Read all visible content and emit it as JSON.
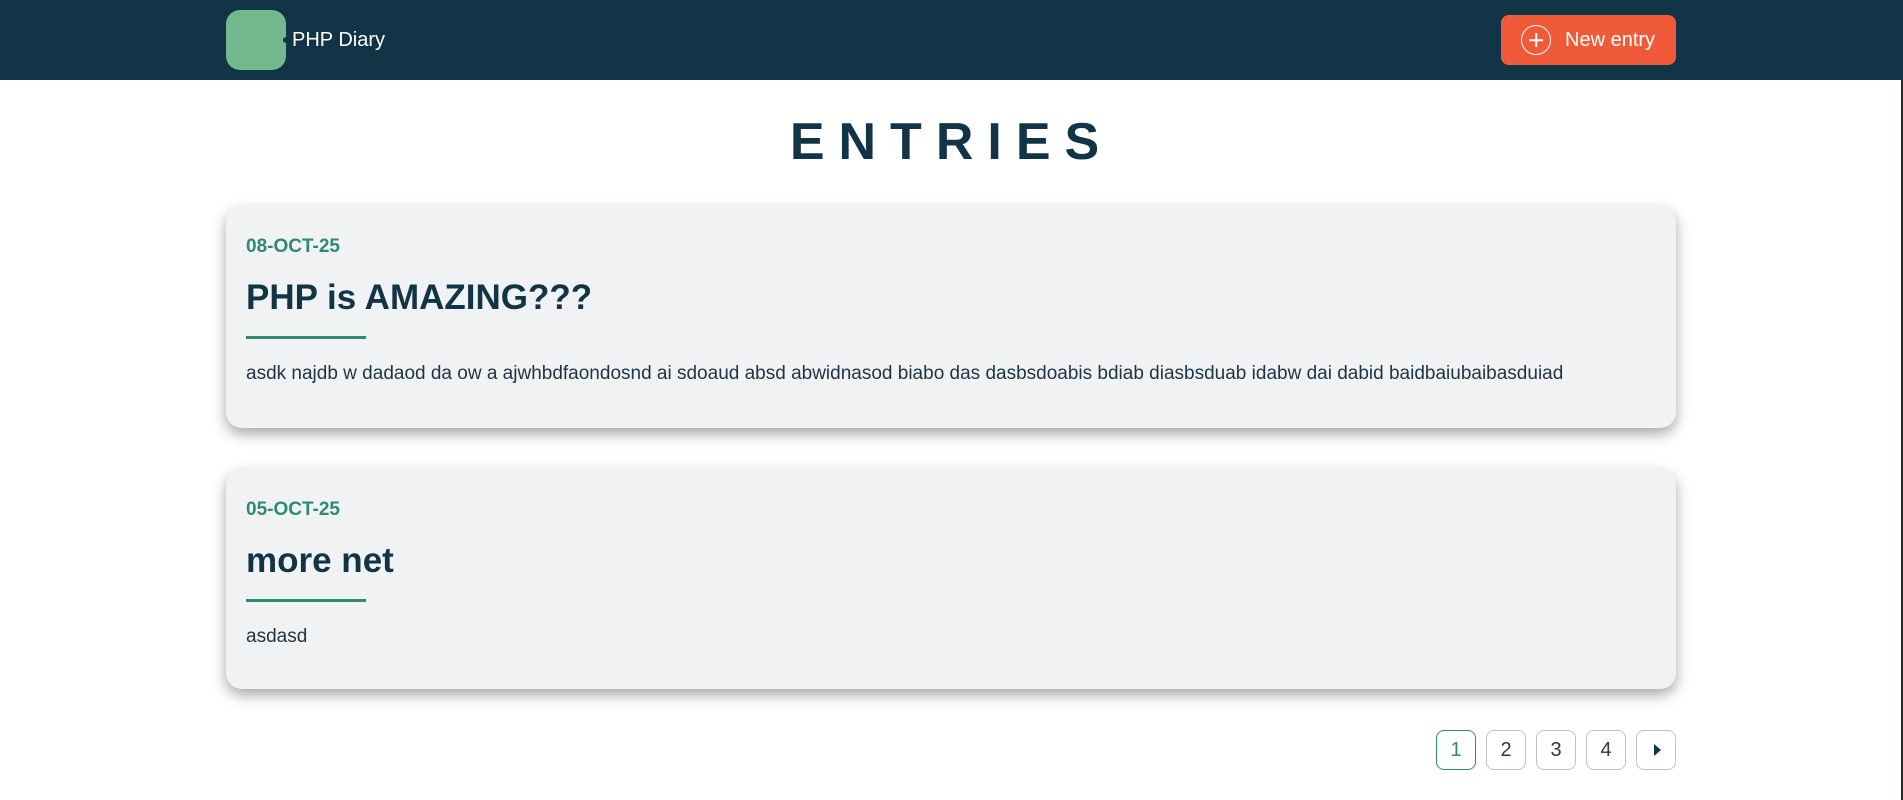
{
  "header": {
    "brand_name": "PHP Diary",
    "new_entry_label": "New entry",
    "logo_color": "#72b88c",
    "background_color": "#123447",
    "accent_color": "#f05a38"
  },
  "page": {
    "title": "ENTRIES"
  },
  "entries": [
    {
      "date": "08-OCT-25",
      "title": "PHP is AMAZING???",
      "body": "asdk najdb w dadaod da ow a ajwhbdfaondosnd ai sdoaud absd abwidnasod biabo das dasbsdoabis bdiab diasbsduab idabw dai dabid baidbaiubaibasduiad"
    },
    {
      "date": "05-OCT-25",
      "title": "more net",
      "body": "asdasd"
    }
  ],
  "pagination": {
    "pages": [
      "1",
      "2",
      "3",
      "4"
    ],
    "current": "1",
    "next_icon": "caret-right-icon"
  }
}
